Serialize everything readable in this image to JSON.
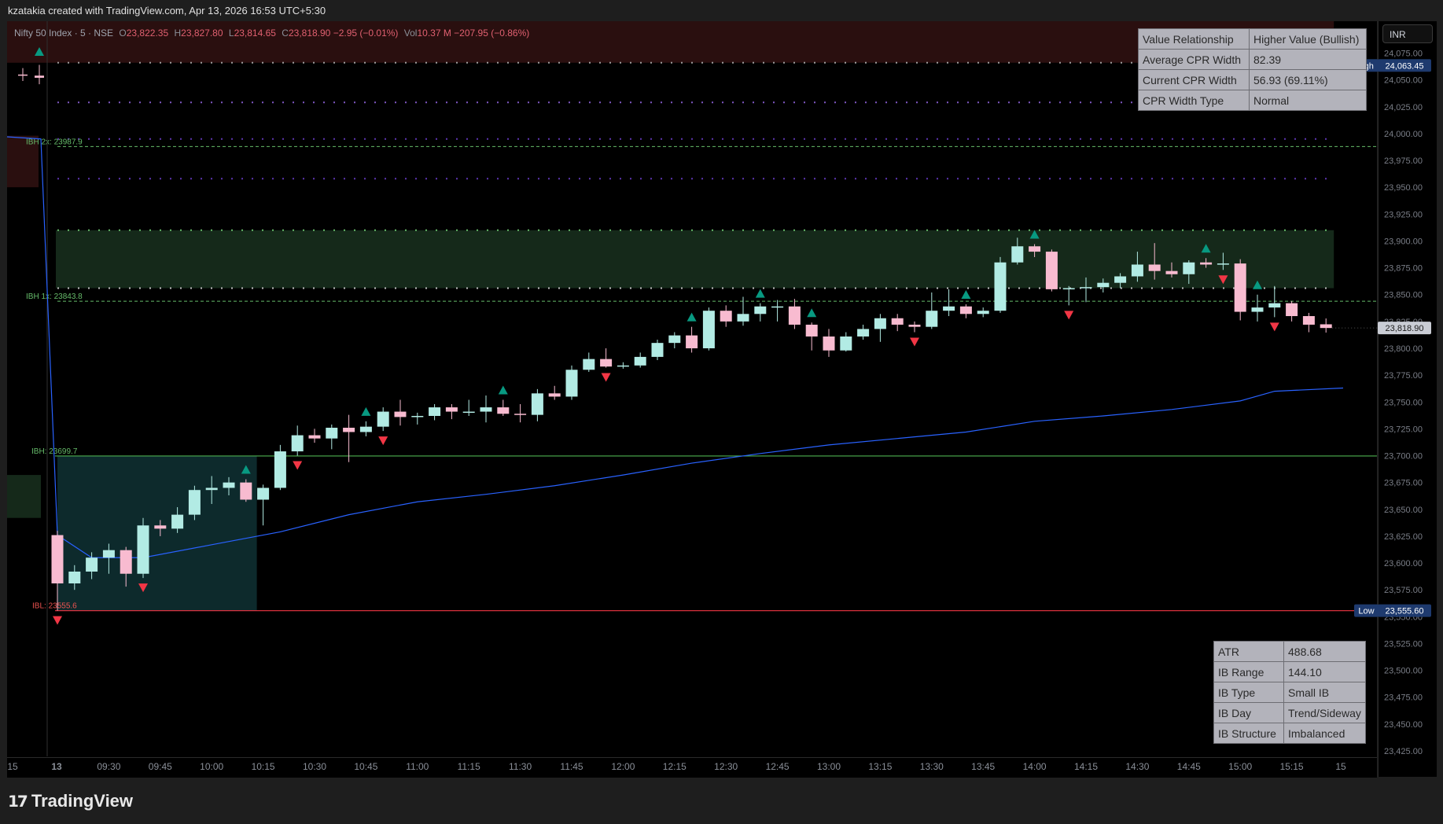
{
  "header": {
    "caption": "kzatakia created with TradingView.com, Apr 13, 2026 16:53 UTC+5:30"
  },
  "legend": {
    "symbol": "Nifty 50 Index · 5 · NSE",
    "open_label": "O",
    "open": "23,822.35",
    "high_label": "H",
    "high": "23,827.80",
    "low_label": "L",
    "low": "23,814.65",
    "close_label": "C",
    "close": "23,818.90",
    "change": "−2.95 (−0.01%)",
    "vol_label": "Vol",
    "volume": "10.37 M",
    "day_change": "−207.95 (−0.86%)"
  },
  "currency_button": "INR",
  "cpr_table": [
    {
      "label": "Value Relationship",
      "value": "Higher Value (Bullish)"
    },
    {
      "label": "Average CPR Width",
      "value": "82.39"
    },
    {
      "label": "Current CPR Width",
      "value": "56.93 (69.11%)"
    },
    {
      "label": "CPR Width Type",
      "value": "Normal"
    }
  ],
  "ib_table": [
    {
      "label": "ATR",
      "value": "488.68"
    },
    {
      "label": "IB Range",
      "value": "144.10"
    },
    {
      "label": "IB Type",
      "value": "Small IB"
    },
    {
      "label": "IB Day",
      "value": "Trend/Sideway"
    },
    {
      "label": "IB Structure",
      "value": "Imbalanced"
    }
  ],
  "price_badges": {
    "high_label": "High",
    "high_value": "24,063.45",
    "low_label": "Low",
    "low_value": "23,555.60",
    "last_value": "23,818.90"
  },
  "brand": "TradingView",
  "colors": {
    "up_candle": "#b2ebe4",
    "down_candle": "#f8bbd0",
    "vwap": "#2962ff",
    "ibh_line": "#4caf50",
    "ibl_line": "#f23645",
    "buy_marker": "#089981",
    "sell_marker": "#f23645",
    "cpr_zone": "#15291a",
    "ib_zone": "#0d2a2c",
    "resistance_zone": "#2a0f0f"
  },
  "chart_data": {
    "type": "candlestick",
    "x_ticks": [
      "15",
      "13",
      "09:30",
      "09:45",
      "10:00",
      "10:15",
      "10:30",
      "10:45",
      "11:00",
      "11:15",
      "11:30",
      "11:45",
      "12:00",
      "12:15",
      "12:30",
      "12:45",
      "13:00",
      "13:15",
      "13:30",
      "13:45",
      "14:00",
      "14:15",
      "14:30",
      "14:45",
      "15:00",
      "15:15",
      "15"
    ],
    "y_ticks": [
      "24,075.00",
      "24,050.00",
      "24,025.00",
      "24,000.00",
      "23,975.00",
      "23,950.00",
      "23,925.00",
      "23,900.00",
      "23,875.00",
      "23,850.00",
      "23,825.00",
      "23,800.00",
      "23,775.00",
      "23,750.00",
      "23,725.00",
      "23,700.00",
      "23,675.00",
      "23,650.00",
      "23,625.00",
      "23,600.00",
      "23,575.00",
      "23,550.00",
      "23,525.00",
      "23,500.00",
      "23,475.00",
      "23,450.00",
      "23,425.00"
    ],
    "ylim": [
      23422,
      24096
    ],
    "prev_day_candles": [
      {
        "o": 24055,
        "h": 24061,
        "l": 24049,
        "c": 24054
      },
      {
        "o": 24054,
        "h": 24064,
        "l": 24046,
        "c": 24052
      }
    ],
    "candles": [
      {
        "t": "09:15",
        "o": 23626,
        "h": 23630,
        "l": 23555.6,
        "c": 23581
      },
      {
        "t": "09:20",
        "o": 23581,
        "h": 23598,
        "l": 23575,
        "c": 23592
      },
      {
        "t": "09:25",
        "o": 23592,
        "h": 23610,
        "l": 23585,
        "c": 23605
      },
      {
        "t": "09:30",
        "o": 23605,
        "h": 23618,
        "l": 23590,
        "c": 23612
      },
      {
        "t": "09:35",
        "o": 23612,
        "h": 23615,
        "l": 23578,
        "c": 23590
      },
      {
        "t": "09:40",
        "o": 23590,
        "h": 23642,
        "l": 23586,
        "c": 23635
      },
      {
        "t": "09:45",
        "o": 23635,
        "h": 23640,
        "l": 23625,
        "c": 23632
      },
      {
        "t": "09:50",
        "o": 23632,
        "h": 23652,
        "l": 23628,
        "c": 23645
      },
      {
        "t": "09:55",
        "o": 23645,
        "h": 23672,
        "l": 23640,
        "c": 23668
      },
      {
        "t": "10:00",
        "o": 23668,
        "h": 23681,
        "l": 23655,
        "c": 23670
      },
      {
        "t": "10:05",
        "o": 23670,
        "h": 23680,
        "l": 23663,
        "c": 23675
      },
      {
        "t": "10:10",
        "o": 23675,
        "h": 23678,
        "l": 23657,
        "c": 23659
      },
      {
        "t": "10:15",
        "o": 23659,
        "h": 23673,
        "l": 23635,
        "c": 23670
      },
      {
        "t": "10:20",
        "o": 23670,
        "h": 23710,
        "l": 23668,
        "c": 23704
      },
      {
        "t": "10:25",
        "o": 23704,
        "h": 23728,
        "l": 23700,
        "c": 23719
      },
      {
        "t": "10:30",
        "o": 23719,
        "h": 23725,
        "l": 23712,
        "c": 23716
      },
      {
        "t": "10:35",
        "o": 23716,
        "h": 23729,
        "l": 23706,
        "c": 23726
      },
      {
        "t": "10:40",
        "o": 23726,
        "h": 23738,
        "l": 23694,
        "c": 23722
      },
      {
        "t": "10:45",
        "o": 23722,
        "h": 23732,
        "l": 23718,
        "c": 23727
      },
      {
        "t": "10:50",
        "o": 23727,
        "h": 23745,
        "l": 23723,
        "c": 23741
      },
      {
        "t": "10:55",
        "o": 23741,
        "h": 23752,
        "l": 23728,
        "c": 23736
      },
      {
        "t": "11:00",
        "o": 23736,
        "h": 23740,
        "l": 23729,
        "c": 23737
      },
      {
        "t": "11:05",
        "o": 23737,
        "h": 23748,
        "l": 23733,
        "c": 23745
      },
      {
        "t": "11:10",
        "o": 23745,
        "h": 23748,
        "l": 23734,
        "c": 23741
      },
      {
        "t": "11:15",
        "o": 23741,
        "h": 23752,
        "l": 23737,
        "c": 23741
      },
      {
        "t": "11:20",
        "o": 23741,
        "h": 23756,
        "l": 23731,
        "c": 23745
      },
      {
        "t": "11:25",
        "o": 23745,
        "h": 23752,
        "l": 23737,
        "c": 23739
      },
      {
        "t": "11:30",
        "o": 23739,
        "h": 23748,
        "l": 23731,
        "c": 23738
      },
      {
        "t": "11:35",
        "o": 23738,
        "h": 23762,
        "l": 23732,
        "c": 23758
      },
      {
        "t": "11:40",
        "o": 23758,
        "h": 23765,
        "l": 23752,
        "c": 23755
      },
      {
        "t": "11:45",
        "o": 23755,
        "h": 23784,
        "l": 23752,
        "c": 23780
      },
      {
        "t": "11:50",
        "o": 23780,
        "h": 23796,
        "l": 23778,
        "c": 23790
      },
      {
        "t": "11:55",
        "o": 23790,
        "h": 23800,
        "l": 23782,
        "c": 23783
      },
      {
        "t": "12:00",
        "o": 23783,
        "h": 23787,
        "l": 23781,
        "c": 23784
      },
      {
        "t": "12:05",
        "o": 23784,
        "h": 23796,
        "l": 23782,
        "c": 23792
      },
      {
        "t": "12:10",
        "o": 23792,
        "h": 23808,
        "l": 23789,
        "c": 23805
      },
      {
        "t": "12:15",
        "o": 23805,
        "h": 23815,
        "l": 23800,
        "c": 23812
      },
      {
        "t": "12:20",
        "o": 23812,
        "h": 23820,
        "l": 23796,
        "c": 23800
      },
      {
        "t": "12:25",
        "o": 23800,
        "h": 23838,
        "l": 23798,
        "c": 23835
      },
      {
        "t": "12:30",
        "o": 23835,
        "h": 23840,
        "l": 23820,
        "c": 23825
      },
      {
        "t": "12:35",
        "o": 23825,
        "h": 23848,
        "l": 23821,
        "c": 23832
      },
      {
        "t": "12:40",
        "o": 23832,
        "h": 23842,
        "l": 23825,
        "c": 23839
      },
      {
        "t": "12:45",
        "o": 23839,
        "h": 23845,
        "l": 23825,
        "c": 23839
      },
      {
        "t": "12:50",
        "o": 23839,
        "h": 23846,
        "l": 23818,
        "c": 23822
      },
      {
        "t": "12:55",
        "o": 23822,
        "h": 23824,
        "l": 23798,
        "c": 23811
      },
      {
        "t": "13:00",
        "o": 23811,
        "h": 23818,
        "l": 23792,
        "c": 23798
      },
      {
        "t": "13:05",
        "o": 23798,
        "h": 23815,
        "l": 23797,
        "c": 23811
      },
      {
        "t": "13:10",
        "o": 23811,
        "h": 23822,
        "l": 23808,
        "c": 23818
      },
      {
        "t": "13:15",
        "o": 23818,
        "h": 23832,
        "l": 23806,
        "c": 23828
      },
      {
        "t": "13:20",
        "o": 23828,
        "h": 23832,
        "l": 23816,
        "c": 23822
      },
      {
        "t": "13:25",
        "o": 23822,
        "h": 23825,
        "l": 23815,
        "c": 23820
      },
      {
        "t": "13:30",
        "o": 23820,
        "h": 23852,
        "l": 23818,
        "c": 23835
      },
      {
        "t": "13:35",
        "o": 23835,
        "h": 23855,
        "l": 23830,
        "c": 23839
      },
      {
        "t": "13:40",
        "o": 23839,
        "h": 23841,
        "l": 23828,
        "c": 23832
      },
      {
        "t": "13:45",
        "o": 23832,
        "h": 23838,
        "l": 23829,
        "c": 23835
      },
      {
        "t": "13:50",
        "o": 23835,
        "h": 23885,
        "l": 23833,
        "c": 23880
      },
      {
        "t": "13:55",
        "o": 23880,
        "h": 23903,
        "l": 23878,
        "c": 23895
      },
      {
        "t": "14:00",
        "o": 23895,
        "h": 23897,
        "l": 23885,
        "c": 23890
      },
      {
        "t": "14:05",
        "o": 23890,
        "h": 23892,
        "l": 23853,
        "c": 23855
      },
      {
        "t": "14:10",
        "o": 23855,
        "h": 23858,
        "l": 23840,
        "c": 23856
      },
      {
        "t": "14:15",
        "o": 23856,
        "h": 23866,
        "l": 23843,
        "c": 23857
      },
      {
        "t": "14:20",
        "o": 23857,
        "h": 23865,
        "l": 23852,
        "c": 23861
      },
      {
        "t": "14:25",
        "o": 23861,
        "h": 23870,
        "l": 23856,
        "c": 23867
      },
      {
        "t": "14:30",
        "o": 23867,
        "h": 23890,
        "l": 23862,
        "c": 23878
      },
      {
        "t": "14:35",
        "o": 23878,
        "h": 23898,
        "l": 23864,
        "c": 23872
      },
      {
        "t": "14:40",
        "o": 23872,
        "h": 23880,
        "l": 23866,
        "c": 23869
      },
      {
        "t": "14:45",
        "o": 23869,
        "h": 23882,
        "l": 23860,
        "c": 23880
      },
      {
        "t": "14:50",
        "o": 23880,
        "h": 23884,
        "l": 23875,
        "c": 23878
      },
      {
        "t": "14:55",
        "o": 23878,
        "h": 23889,
        "l": 23873,
        "c": 23879
      },
      {
        "t": "15:00",
        "o": 23879,
        "h": 23883,
        "l": 23826,
        "c": 23834
      },
      {
        "t": "15:05",
        "o": 23834,
        "h": 23850,
        "l": 23825,
        "c": 23838
      },
      {
        "t": "15:10",
        "o": 23838,
        "h": 23858,
        "l": 23829,
        "c": 23842
      },
      {
        "t": "15:15",
        "o": 23842,
        "h": 23844,
        "l": 23825,
        "c": 23830
      },
      {
        "t": "15:20",
        "o": 23830,
        "h": 23833,
        "l": 23815,
        "c": 23822
      },
      {
        "t": "15:25",
        "o": 23822.35,
        "h": 23827.8,
        "l": 23814.65,
        "c": 23818.9
      }
    ],
    "vwap": [
      {
        "t": "09:15",
        "v": 23626
      },
      {
        "t": "09:25",
        "v": 23605
      },
      {
        "t": "09:40",
        "v": 23605
      },
      {
        "t": "10:00",
        "v": 23617
      },
      {
        "t": "10:20",
        "v": 23629
      },
      {
        "t": "10:40",
        "v": 23645
      },
      {
        "t": "11:00",
        "v": 23657
      },
      {
        "t": "11:20",
        "v": 23664
      },
      {
        "t": "11:40",
        "v": 23672
      },
      {
        "t": "12:00",
        "v": 23682
      },
      {
        "t": "12:20",
        "v": 23693
      },
      {
        "t": "12:40",
        "v": 23702
      },
      {
        "t": "13:00",
        "v": 23710
      },
      {
        "t": "13:20",
        "v": 23716
      },
      {
        "t": "13:40",
        "v": 23722
      },
      {
        "t": "14:00",
        "v": 23732
      },
      {
        "t": "14:20",
        "v": 23737
      },
      {
        "t": "14:40",
        "v": 23743
      },
      {
        "t": "15:00",
        "v": 23751
      },
      {
        "t": "15:10",
        "v": 23760
      },
      {
        "t": "15:30",
        "v": 23763
      }
    ],
    "levels": {
      "ibh": {
        "label": "IBH: 23699.7",
        "value": 23699.7
      },
      "ibl": {
        "label": "IBL: 23555.6",
        "value": 23555.6
      },
      "ibh_1x": {
        "label": "IBH 1x: 23843.8",
        "value": 23843.8
      },
      "ibh_2x": {
        "label": "IBH 2x: 23987.9",
        "value": 23987.9
      }
    },
    "zones": {
      "cpr_top": 23910,
      "cpr_bottom": 23856,
      "resistance_top": 24096,
      "resistance_bottom": 24066
    },
    "buy_signals": [
      "10:10",
      "10:45",
      "11:25",
      "12:20",
      "12:40",
      "12:55",
      "13:40",
      "14:00",
      "14:50",
      "15:05"
    ],
    "sell_signals": [
      "09:15",
      "09:40",
      "10:25",
      "10:50",
      "11:55",
      "13:25",
      "14:10",
      "14:55",
      "15:10"
    ]
  }
}
